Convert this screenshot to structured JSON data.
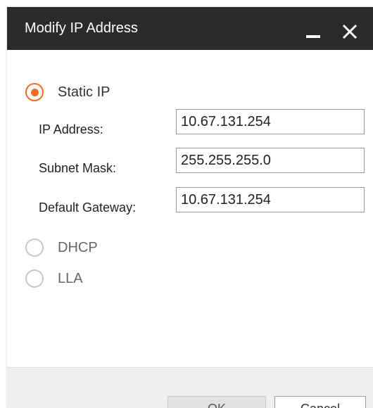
{
  "dialog": {
    "title": "Modify IP Address"
  },
  "options": {
    "static_ip": {
      "label": "Static IP",
      "selected": true
    },
    "dhcp": {
      "label": "DHCP",
      "selected": false
    },
    "lla": {
      "label": "LLA",
      "selected": false
    }
  },
  "fields": {
    "ip_address": {
      "label": "IP Address:",
      "value": "10.67.131.254"
    },
    "subnet_mask": {
      "label": "Subnet Mask:",
      "value": "255.255.255.0"
    },
    "default_gateway": {
      "label": "Default Gateway:",
      "value": "10.67.131.254"
    }
  },
  "buttons": {
    "ok": "OK",
    "cancel": "Cancel"
  },
  "colors": {
    "accent": "#f26a21",
    "titlebar": "#2b2b2b"
  }
}
